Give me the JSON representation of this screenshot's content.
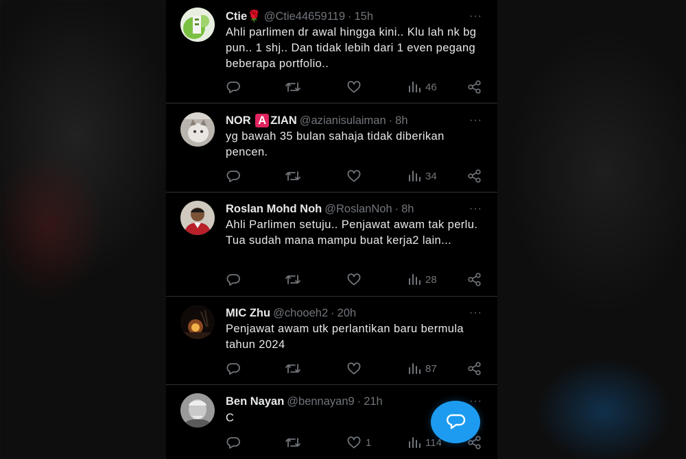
{
  "tweets": [
    {
      "name": "Ctie",
      "name_emoji": "🌹",
      "handle": "@Ctie44659119",
      "time": "15h",
      "text": "Ahli parlimen dr awal hingga kini.. Klu lah nk bg pun.. 1 shj.. Dan tidak lebih dari 1 even pegang beberapa portfolio..",
      "likes": "",
      "views": "46"
    },
    {
      "name_prefix": "NOR ",
      "name_badge": "A",
      "name_suffix": "ZIAN",
      "handle": "@azianisulaiman",
      "time": "8h",
      "text": "yg bawah 35 bulan sahaja tidak diberikan pencen.",
      "likes": "",
      "views": "34"
    },
    {
      "name": "Roslan Mohd Noh",
      "handle": "@RoslanNoh",
      "time": "8h",
      "text": "Ahli Parlimen setuju.. Penjawat awam tak perlu. Tua sudah mana mampu buat kerja2 lain...",
      "likes": "",
      "views": "28"
    },
    {
      "name": "MIC Zhu",
      "handle": "@chooeh2",
      "time": "20h",
      "text": "Penjawat awam utk perlantikan baru bermula tahun 2024",
      "likes": "",
      "views": "87"
    },
    {
      "name": "Ben Nayan",
      "handle": "@bennayan9",
      "time": "21h",
      "text": "C",
      "likes": "1",
      "views": "114"
    }
  ],
  "more_glyph": "···",
  "separator": "·",
  "colors": {
    "background": "#000000",
    "text_primary": "#e7e9ea",
    "text_secondary": "#71767b",
    "accent": "#1d9bf0",
    "divider": "#2f3336"
  },
  "icons": {
    "reply": "reply-icon",
    "retweet": "retweet-icon",
    "like": "like-icon",
    "views": "views-icon",
    "share": "share-icon",
    "compose": "compose-message-icon"
  }
}
